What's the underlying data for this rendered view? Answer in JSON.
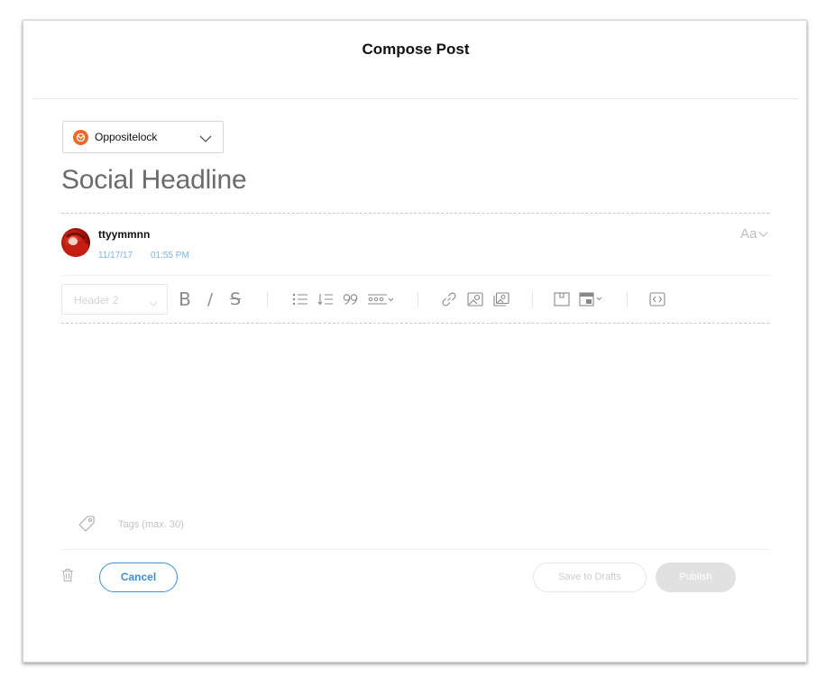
{
  "modal": {
    "title": "Compose Post"
  },
  "blog_select": {
    "selected": "Oppositelock",
    "logo_color": "#f26a2b",
    "icon": "chevron-down-icon"
  },
  "post": {
    "headline": "Social Headline"
  },
  "author": {
    "name": "ttyymmnn",
    "date": "11/17/17",
    "time": "01:55 PM"
  },
  "font_toggle": {
    "label": "Aa",
    "icon": "chevron-down-icon"
  },
  "toolbar": {
    "heading_select": "Header 2",
    "bold": "B",
    "italic": "/",
    "strike": "S",
    "icons": [
      "bold-icon",
      "italic-icon",
      "strikethrough-icon",
      "bulleted-list-icon",
      "numbered-list-icon",
      "quote-icon",
      "more-options-icon",
      "link-icon",
      "image-icon",
      "gallery-icon",
      "frame-icon",
      "layout-icon",
      "embed-icon"
    ]
  },
  "tags": {
    "placeholder": "Tags (max. 30)"
  },
  "actions": {
    "cancel": "Cancel",
    "save_drafts": "Save to Drafts",
    "publish": "Publish"
  },
  "colors": {
    "accent": "#3d8fd8",
    "date_text": "#7ab4e6",
    "publish_disabled": "#e1e1e1"
  }
}
